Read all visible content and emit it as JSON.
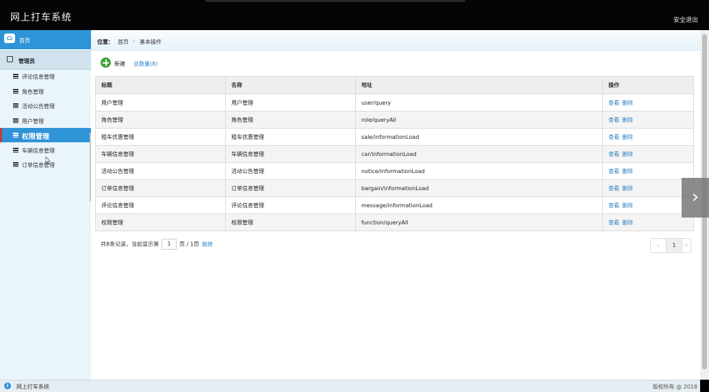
{
  "header": {
    "title": "网上打车系统",
    "logout": "安全退出"
  },
  "sidebar": {
    "home": "首页",
    "admin": "管理员",
    "items": [
      {
        "label": "评论信息管理"
      },
      {
        "label": "角色管理"
      },
      {
        "label": "活动公告管理"
      },
      {
        "label": "用户管理"
      },
      {
        "label": "权限管理",
        "active": true
      },
      {
        "label": "车辆信息管理"
      },
      {
        "label": "订单信息管理"
      }
    ]
  },
  "breadcrumb": {
    "prefix": "位置：",
    "home": "首页",
    "separator": "›",
    "current": "基本操作"
  },
  "toolbar": {
    "new_label": "新建",
    "total_label": "总数量(8)"
  },
  "table": {
    "headers": [
      "标题",
      "名称",
      "地址",
      "操作"
    ],
    "actions": [
      "查看",
      "删除"
    ],
    "rows": [
      {
        "title": "用户管理",
        "name": "用户管理",
        "url": "user/query"
      },
      {
        "title": "角色管理",
        "name": "角色管理",
        "url": "role/queryAll"
      },
      {
        "title": "租车优惠管理",
        "name": "租车优惠管理",
        "url": "sale/informationLoad"
      },
      {
        "title": "车辆信息管理",
        "name": "车辆信息管理",
        "url": "car/informationLoad"
      },
      {
        "title": "活动公告管理",
        "name": "活动公告管理",
        "url": "notice/informationLoad"
      },
      {
        "title": "订单信息管理",
        "name": "订单信息管理",
        "url": "bargain/informationLoad"
      },
      {
        "title": "评论信息管理",
        "name": "评论信息管理",
        "url": "message/informationLoad"
      },
      {
        "title": "权限管理",
        "name": "权限管理",
        "url": "function/queryAll"
      }
    ]
  },
  "pagination": {
    "records_text": "共8条记录，当前显示第",
    "page_value": "1",
    "page_suffix": "页 / 1页",
    "jump": "跳转",
    "prev": "‹",
    "current": "1",
    "next": "›"
  },
  "footer": {
    "app_name": "网上打车系统",
    "copyright": "版权所有 @ 2018"
  },
  "overlay": {
    "next_arrow": "›"
  },
  "colors": {
    "accent": "#2f93d7",
    "link": "#2a7fc2",
    "new_button": "#3ea238",
    "header_bg": "#050505"
  }
}
